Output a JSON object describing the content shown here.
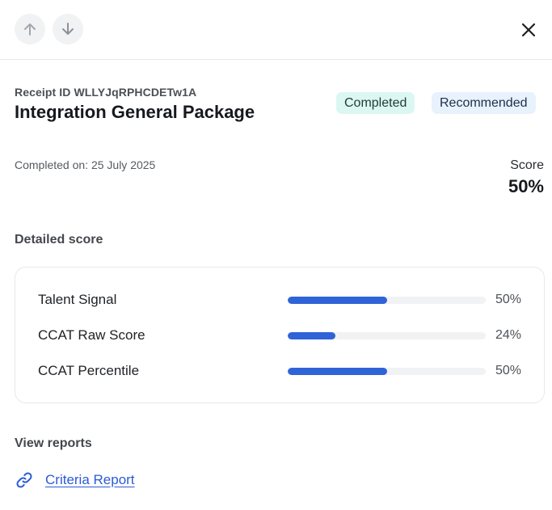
{
  "header": {
    "prev_icon": "arrow-up-icon",
    "next_icon": "arrow-down-icon",
    "close_icon": "close-icon"
  },
  "receipt": {
    "id_label": "Receipt ID WLLYJqRPHCDETw1A",
    "title": "Integration General Package"
  },
  "badges": [
    {
      "label": "Completed",
      "color": "#dcf7f1"
    },
    {
      "label": "Recommended",
      "color": "#e8f2fd"
    }
  ],
  "completed_on": "Completed on: 25 July 2025",
  "score": {
    "label": "Score",
    "value": "50%"
  },
  "detailed_score": {
    "heading": "Detailed score",
    "bar_color": "#2f63d8",
    "rows": [
      {
        "label": "Talent Signal",
        "percent": 50,
        "display": "50%"
      },
      {
        "label": "CCAT Raw Score",
        "percent": 24,
        "display": "24%"
      },
      {
        "label": "CCAT Percentile",
        "percent": 50,
        "display": "50%"
      }
    ]
  },
  "reports": {
    "heading": "View reports",
    "items": [
      {
        "label": "Criteria Report",
        "icon": "link-icon"
      }
    ]
  }
}
